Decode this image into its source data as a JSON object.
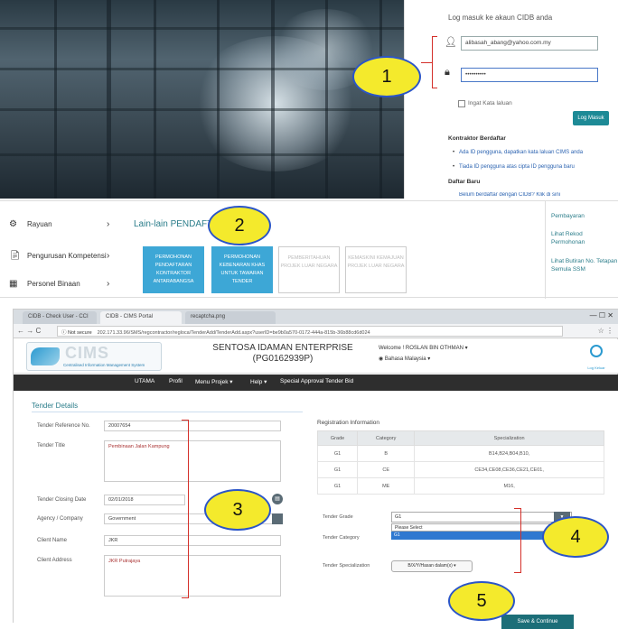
{
  "login": {
    "title": "Log masuk ke akaun CIDB anda",
    "username_value": "alibasah_abang@yahoo.com.my",
    "password_value": "••••••••••",
    "remember_label": "Ingat Kata laluan",
    "login_button": "Log Masuk",
    "registered_heading": "Kontraktor Berdaftar",
    "registered_items": [
      "Ada ID pengguna, dapatkan kata laluan CIMS anda",
      "Tiada ID pengguna atas cipta ID pengguna baru"
    ],
    "new_heading": "Daftar Baru",
    "new_item": "Belum berdaftar dengan CIDB? Klik di sini"
  },
  "callouts": [
    "1",
    "2",
    "3",
    "4",
    "5"
  ],
  "sidebar": {
    "items": [
      {
        "label": "Rayuan",
        "icon": "appeal-icon"
      },
      {
        "label": "Pengurusan Kompetensi",
        "icon": "competency-icon"
      },
      {
        "label": "Personel Binaan",
        "icon": "personnel-icon"
      }
    ],
    "chevron": "›"
  },
  "lain_lain": {
    "title": "Lain-lain PENDAFTARAN",
    "tiles": [
      "PERMOHONAN PENDAFTARAN KONTRAKTOR ANTARABANGSA",
      "PERMOHONAN KEBENARAN KHAS UNTUK TAWARAN TENDER",
      "PEMBERITAHUAN PROJEK LUAR NEGARA",
      "KEMASKINI KEMAJUAN PROJEK LUAR NEGARA"
    ],
    "right_links": [
      "Pembayaran",
      "Lihat Rekod Permohonan",
      "Lihat Butiran No. Tetapan Semula SSM"
    ]
  },
  "browser": {
    "tabs": [
      "CIDB - Check User - CCI",
      "CIDB - CIMS Portal",
      "recaptcha.png"
    ],
    "window_controls": "—  ☐  ✕",
    "nav": "←  →  C",
    "security": "ⓘ Not secure",
    "url": "202.171.33.96/SMS/regcontractor/regloca/TenderAdd/TenderAdd.aspx?userID=be9b0a570-0172-444a-815b-36b88cd6d024",
    "addr_right": "☆  ⋮"
  },
  "cims": {
    "logo_text": "CIMS",
    "logo_sub": "Centralised Information Management System",
    "company": "SENTOSA IDAMAN ENTERPRISE (PG0162939P)",
    "welcome": "Welcome ! ROSLAN BIN OTHMAN ▾",
    "language": "Bahasa Malaysia ▾",
    "logout": "Log Keluar"
  },
  "menu": [
    "UTAMA",
    "Profil",
    "Menu Projek ▾",
    "Help ▾",
    "Special Approval Tender Bid"
  ],
  "tender": {
    "title": "Tender Details",
    "fields": {
      "ref_label": "Tender Reference No.",
      "ref_value": "20007654",
      "title_label": "Tender Title",
      "title_value": "Pembinaan Jalan Kampung",
      "closing_label": "Tender Closing Date",
      "closing_value": "02/01/2018",
      "agency_label": "Agency / Company",
      "agency_value": "Government",
      "client_label": "Client Name",
      "client_value": "JKR",
      "address_label": "Client Address",
      "address_value": "JKR Putrajaya"
    }
  },
  "registration": {
    "title": "Registration Information",
    "headers": [
      "Grade",
      "Category",
      "Specialization"
    ],
    "rows": [
      [
        "G1",
        "B",
        "B14,B24,B04,B10,"
      ],
      [
        "G1",
        "CE",
        "CE34,CE08,CE36,CE21,CE01,"
      ],
      [
        "G1",
        "ME",
        "M16,"
      ]
    ]
  },
  "grade": {
    "grade_label": "Tender Grade",
    "grade_value": "G1",
    "options": [
      "Please Select",
      "G1"
    ],
    "category_label": "Tender Category",
    "spec_label": "Tender Specialization",
    "spec_button": "B/X/Y/Hasan dalam(x) ▾",
    "save_button": "Save & Continue"
  },
  "colors": {
    "accent": "#2b7d8a",
    "callout_fill": "#f4ea2c",
    "callout_border": "#2b55c8",
    "bracket": "#d4302a",
    "tile_active": "#3da7d6",
    "menubar": "#2e2e2e"
  }
}
